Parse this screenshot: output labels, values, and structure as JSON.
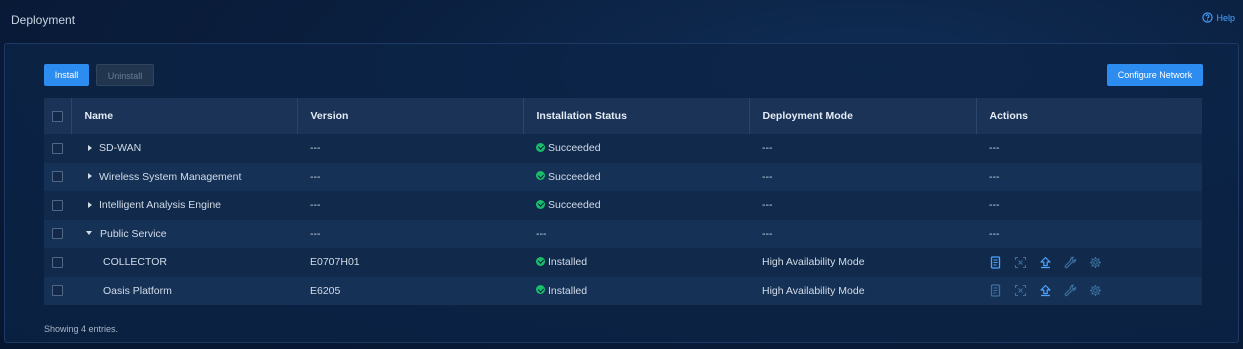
{
  "header": {
    "title": "Deployment",
    "help_label": "Help"
  },
  "toolbar": {
    "install_label": "Install",
    "uninstall_label": "Uninstall",
    "configure_network_label": "Configure Network"
  },
  "table": {
    "columns": [
      "Name",
      "Version",
      "Installation Status",
      "Deployment Mode",
      "Actions"
    ],
    "rows": [
      {
        "name": "SD-WAN",
        "version": "---",
        "status": "Succeeded",
        "mode": "---",
        "actions": "---"
      },
      {
        "name": "Wireless System Management",
        "version": "---",
        "status": "Succeeded",
        "mode": "---",
        "actions": "---"
      },
      {
        "name": "Intelligent Analysis Engine",
        "version": "---",
        "status": "Succeeded",
        "mode": "---",
        "actions": "---"
      },
      {
        "name": "Public Service",
        "version": "---",
        "status": "---",
        "mode": "---",
        "actions": "---"
      },
      {
        "name": "COLLECTOR",
        "version": "E0707H01",
        "status": "Installed",
        "mode": "High Availability Mode"
      },
      {
        "name": "Oasis Platform",
        "version": "E6205",
        "status": "Installed",
        "mode": "High Availability Mode"
      }
    ]
  },
  "footer": {
    "text": "Showing 4 entries."
  },
  "colors": {
    "accent": "#2d8cf0",
    "success": "#19be6b",
    "background": "#0a1e3d"
  },
  "icons": {
    "help": "help-circle-icon",
    "status_ok": "check-circle-icon",
    "details": "document-icon",
    "scan": "scan-icon",
    "upgrade": "upload-icon",
    "repair": "wrench-icon",
    "settings": "gear-icon"
  }
}
